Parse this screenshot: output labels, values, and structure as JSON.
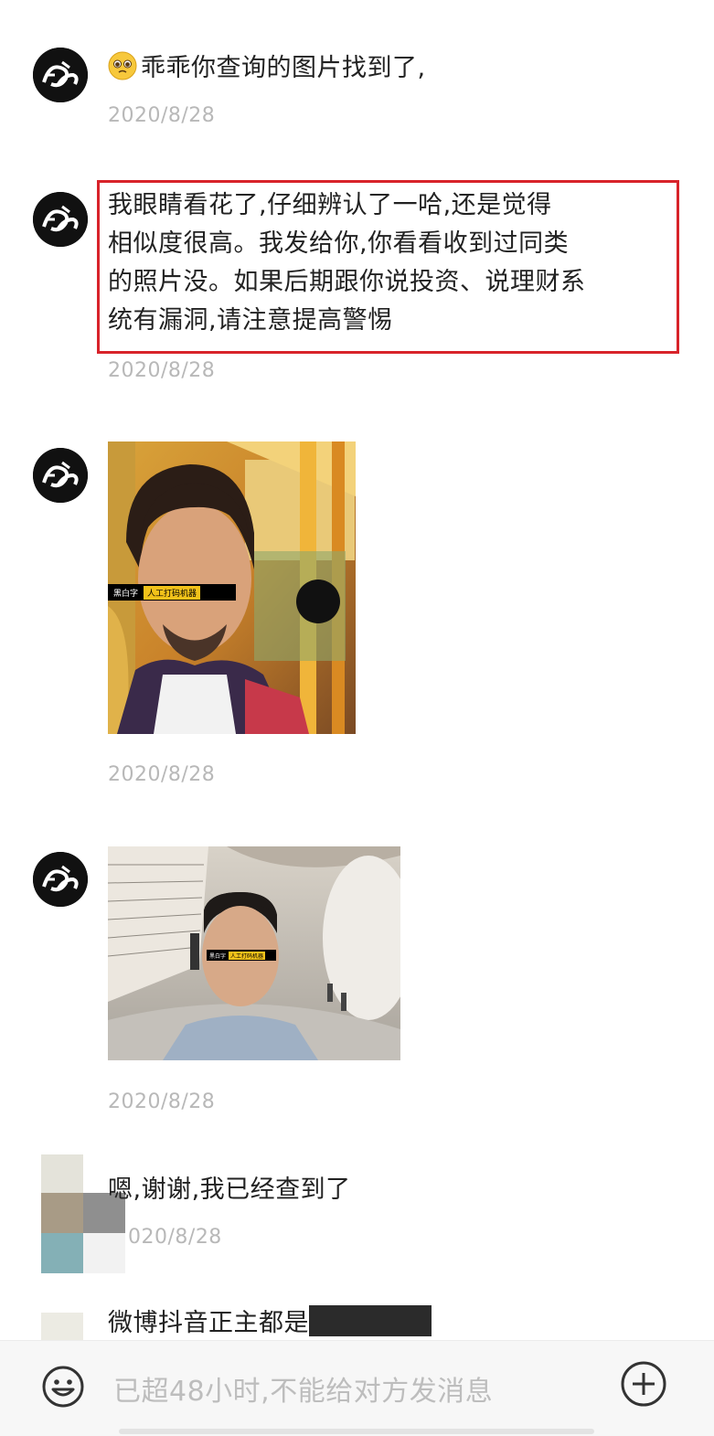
{
  "messages": [
    {
      "text": "乖乖你查询的图片找到了,",
      "time": "2020/8/28",
      "emoji": "pleading-face"
    },
    {
      "lines": [
        "我眼睛看花了,仔细辨认了一哈,还是觉得",
        "相似度很高。我发给你,你看看收到过同类",
        "的照片没。如果后期跟你说投资、说理财系",
        "统有漏洞,请注意提高警惕"
      ],
      "time": "2020/8/28"
    },
    {
      "censor_left": "黑白字",
      "censor_tag": "人工打码机器",
      "time": "2020/8/28"
    },
    {
      "censor_left": "黑白字",
      "censor_tag": "人工打码机器",
      "time": "2020/8/28"
    },
    {
      "text": "嗯,谢谢,我已经查到了",
      "time": "020/8/28"
    },
    {
      "text": "微博抖音正主都是"
    }
  ],
  "input_bar": {
    "placeholder": "已超48小时,不能给对方发消息"
  },
  "colors": {
    "highlight_border": "#d8232a",
    "timestamp": "#b8b8b8",
    "background": "#ffffff"
  },
  "icons": [
    "avatar-logo-icon",
    "pleading-face-emoji-icon",
    "emoji-face-icon",
    "plus-circle-icon"
  ]
}
